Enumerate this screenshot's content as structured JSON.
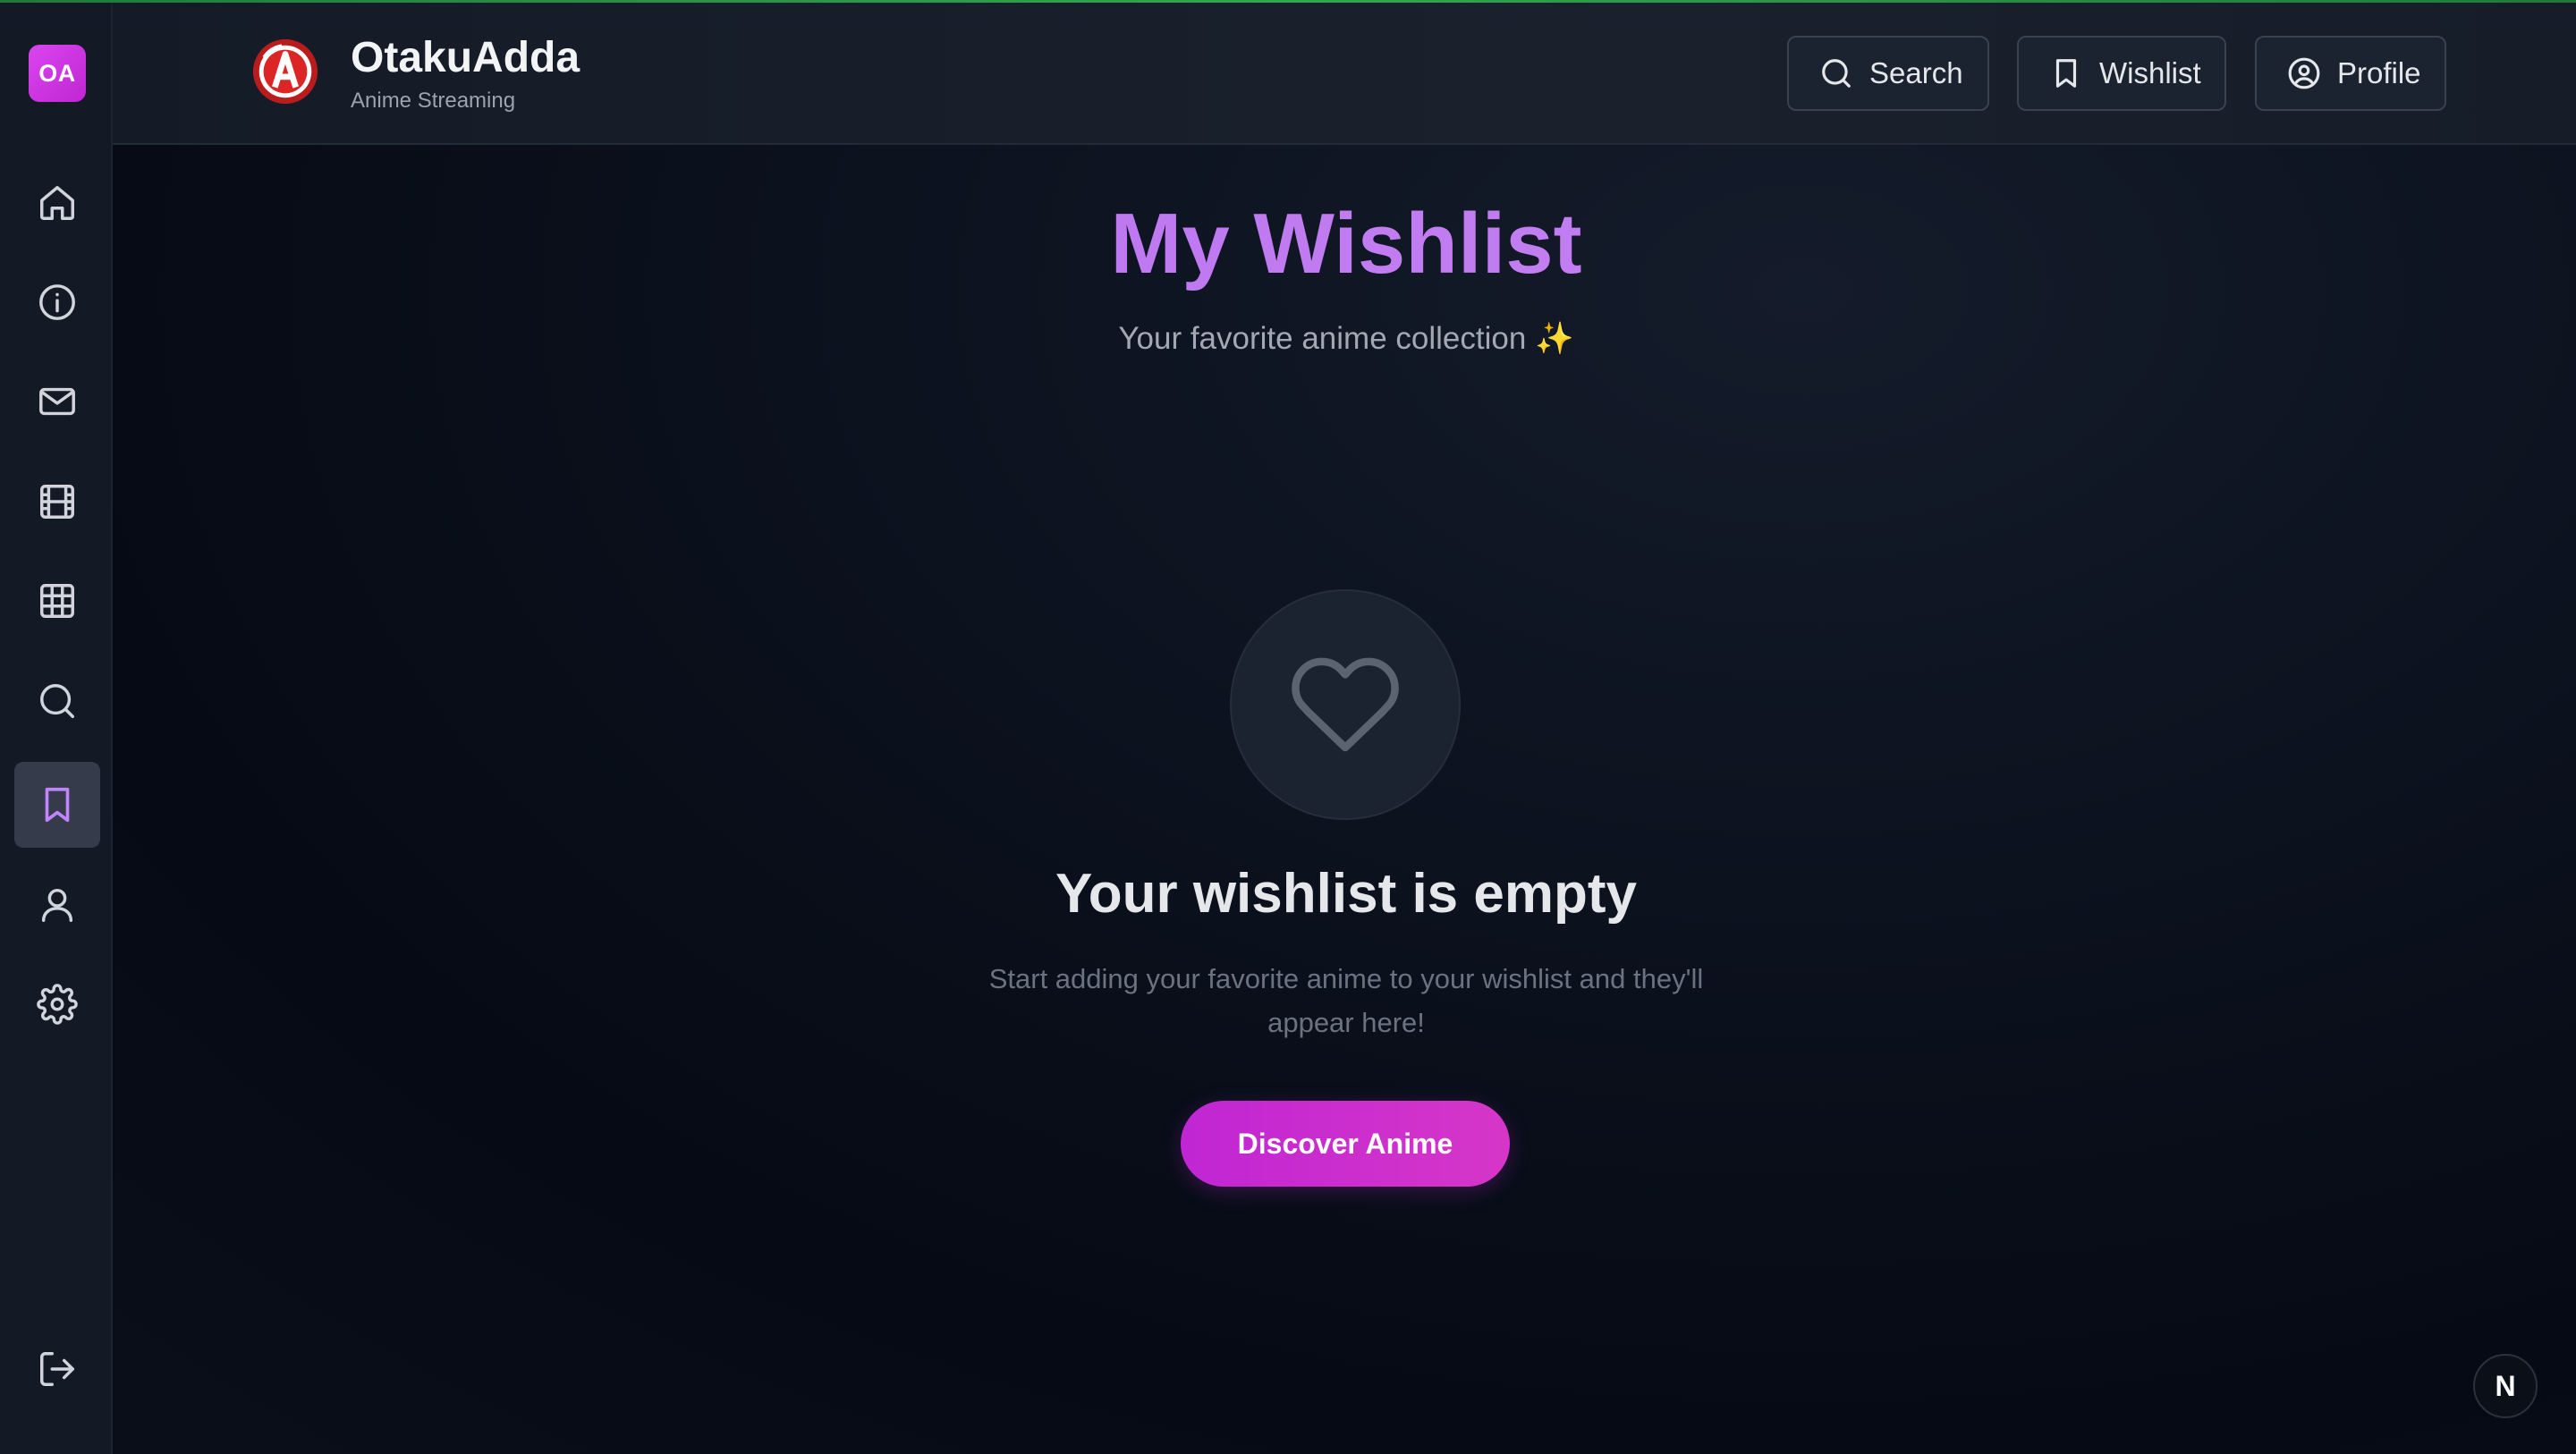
{
  "sidebar": {
    "logo_text": "OA",
    "items": [
      {
        "name": "home",
        "icon": "home-icon"
      },
      {
        "name": "about",
        "icon": "info-icon"
      },
      {
        "name": "contact",
        "icon": "mail-icon"
      },
      {
        "name": "movies",
        "icon": "film-icon"
      },
      {
        "name": "browse",
        "icon": "grid-icon"
      },
      {
        "name": "search",
        "icon": "search-icon"
      },
      {
        "name": "wishlist",
        "icon": "bookmark-icon",
        "active": true
      },
      {
        "name": "profile",
        "icon": "user-icon"
      },
      {
        "name": "settings",
        "icon": "gear-icon"
      }
    ],
    "logout_icon": "logout-icon"
  },
  "header": {
    "brand_name": "OtakuAdda",
    "brand_sub": "Anime Streaming",
    "search_label": "Search",
    "wishlist_label": "Wishlist",
    "profile_label": "Profile"
  },
  "main": {
    "title": "My Wishlist",
    "subtitle": "Your favorite anime collection ✨",
    "empty_title": "Your wishlist is empty",
    "empty_desc": "Start adding your favorite anime to your wishlist and they'll appear here!",
    "cta_label": "Discover Anime"
  },
  "badge": {
    "text": "N"
  },
  "colors": {
    "accent": "#c026d3",
    "title": "#c07cf0",
    "active_icon": "#c084fc",
    "status_line": "#2fa84f"
  }
}
